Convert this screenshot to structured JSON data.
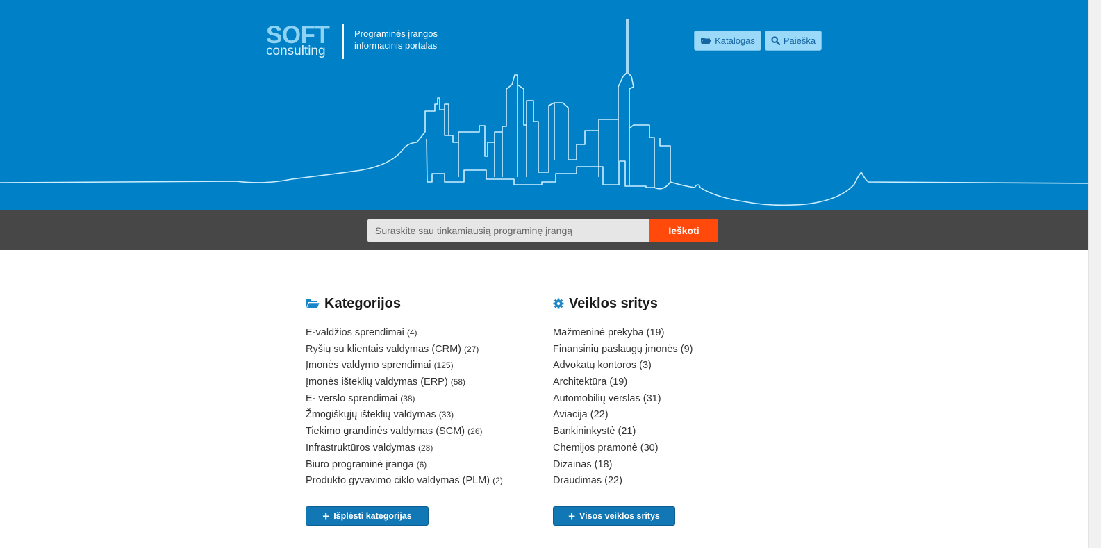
{
  "header": {
    "logo_main": "SOFT",
    "logo_sub": "consulting",
    "tagline_line1": "Programinės įrangos",
    "tagline_line2": "informacinis portalas",
    "nav": [
      {
        "label": "Katalogas",
        "icon": "folder-open-icon"
      },
      {
        "label": "Paieška",
        "icon": "search-icon"
      }
    ]
  },
  "search": {
    "placeholder": "Suraskite sau tinkamiausią programinę įrangą",
    "button_label": "Ieškoti"
  },
  "categories": {
    "heading": "Kategorijos",
    "icon": "folder-open-icon",
    "items": [
      {
        "label": "E-valdžios sprendimai",
        "count": "(4)"
      },
      {
        "label": "Ryšių su klientais valdymas (CRM)",
        "count": "(27)"
      },
      {
        "label": "Įmonės valdymo sprendimai",
        "count": "(125)"
      },
      {
        "label": "Įmonės išteklių valdymas (ERP)",
        "count": "(58)"
      },
      {
        "label": "E- verslo sprendimai",
        "count": "(38)"
      },
      {
        "label": "Žmogiškųjų išteklių valdymas",
        "count": "(33)"
      },
      {
        "label": "Tiekimo grandinės valdymas (SCM)",
        "count": "(26)"
      },
      {
        "label": "Infrastruktūros valdymas",
        "count": "(28)"
      },
      {
        "label": "Biuro programinė įranga",
        "count": "(6)"
      },
      {
        "label": "Produkto gyvavimo ciklo valdymas (PLM)",
        "count": "(2)"
      }
    ],
    "expand_label": "Išplėsti kategorijas"
  },
  "sectors": {
    "heading": "Veiklos sritys",
    "icon": "gear-icon",
    "items": [
      {
        "label": "Mažmeninė prekyba",
        "count": "(19)"
      },
      {
        "label": "Finansinių paslaugų įmonės",
        "count": "(9)"
      },
      {
        "label": "Advokatų kontoros",
        "count": "(3)"
      },
      {
        "label": "Architektūra",
        "count": "(19)"
      },
      {
        "label": "Automobilių verslas",
        "count": "(31)"
      },
      {
        "label": "Aviacija",
        "count": "(22)"
      },
      {
        "label": "Bankininkystė",
        "count": "(21)"
      },
      {
        "label": "Chemijos pramonė",
        "count": "(30)"
      },
      {
        "label": "Dizainas",
        "count": "(18)"
      },
      {
        "label": "Draudimas",
        "count": "(22)"
      }
    ],
    "expand_label": "Visos veiklos sritys"
  },
  "colors": {
    "hero_blue": "#0080c6",
    "search_band": "#474747",
    "search_button": "#ff4a0c",
    "action_button": "#1277b5",
    "nav_button": "#9ad9f7"
  }
}
